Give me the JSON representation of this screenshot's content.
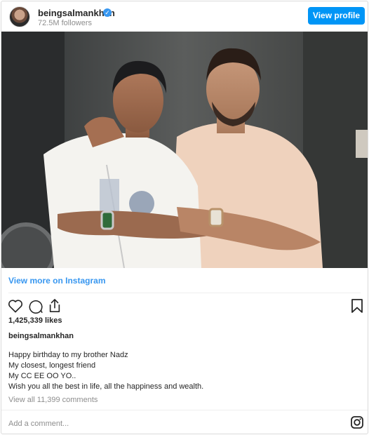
{
  "header": {
    "username": "beingsalmankhan",
    "followers": "72.5M followers",
    "view_profile_label": "View profile"
  },
  "post": {
    "view_more_label": "View more on Instagram",
    "likes": "1,425,339 likes",
    "caption_username": "beingsalmankhan",
    "caption_lines": [
      "Happy birthday to my brother Nadz",
      "My closest, longest friend",
      "My CC EE OO YO..",
      "Wish you all the best in life, all the happiness and wealth."
    ],
    "view_comments_label": "View all 11,399 comments",
    "comment_placeholder": "Add a comment..."
  },
  "icons": {
    "like": "heart-icon",
    "comment": "comment-icon",
    "share": "share-icon",
    "save": "bookmark-icon",
    "instagram": "instagram-icon",
    "verified": "verified-badge-icon"
  },
  "colors": {
    "accent": "#0095f6",
    "link": "#3897f0",
    "muted": "#8e8e8e",
    "text": "#262626"
  }
}
